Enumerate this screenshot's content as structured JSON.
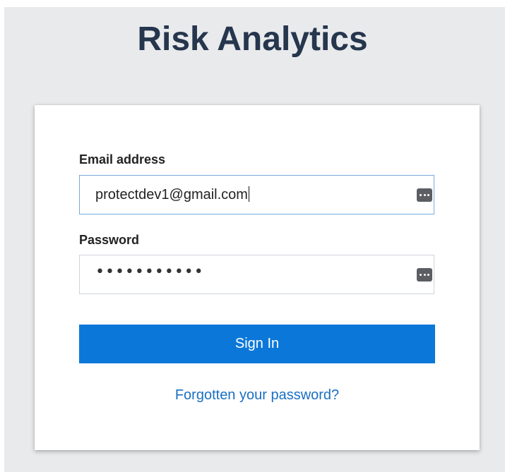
{
  "app": {
    "title": "Risk Analytics"
  },
  "login": {
    "email_label": "Email address",
    "email_value": "protectdev1@gmail.com",
    "password_label": "Password",
    "password_masked": "•••••••••••",
    "submit_label": "Sign In",
    "forgot_label": "Forgotten your password?"
  },
  "icons": {
    "email_field_icon": "password-manager-icon",
    "password_field_icon": "password-manager-icon"
  },
  "colors": {
    "background": "#e9eaec",
    "title": "#25364d",
    "primary_button": "#0b78d9",
    "link": "#1a6fc2",
    "focused_border": "#7aa9db"
  }
}
